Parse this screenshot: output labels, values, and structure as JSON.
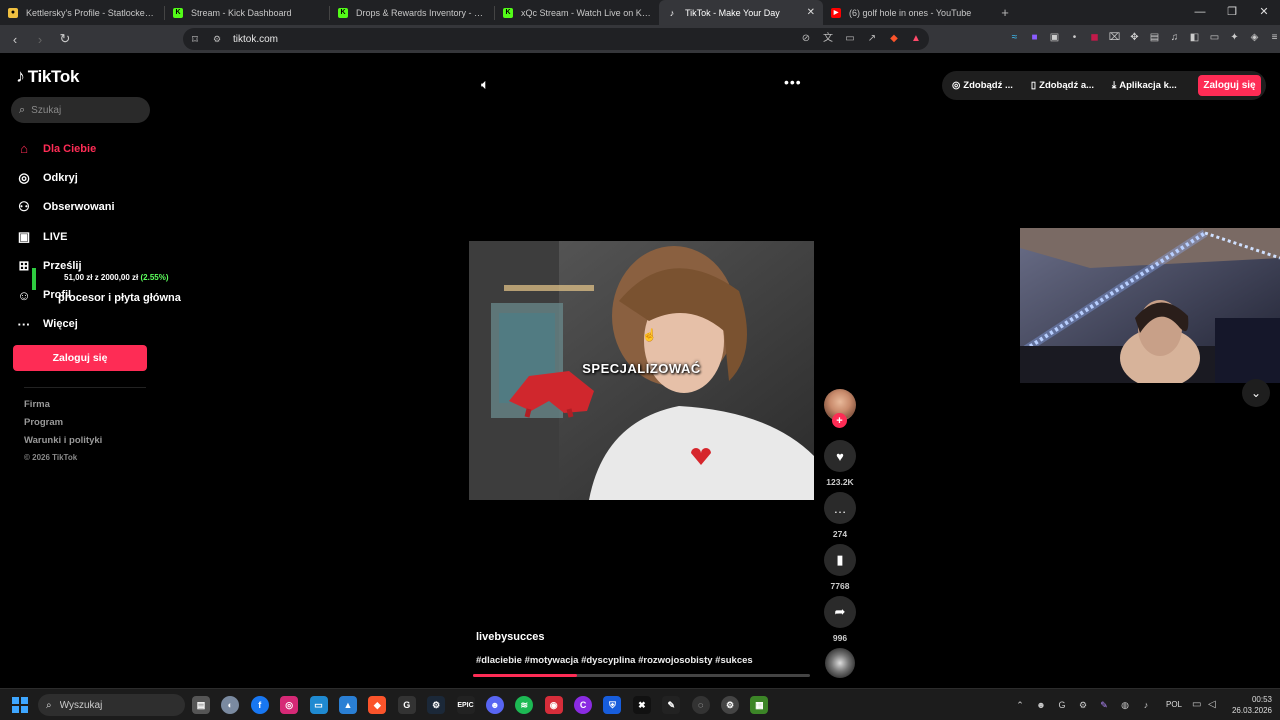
{
  "browser": {
    "tabs": [
      {
        "title": "Kettlersky's Profile - Statlocker.gg",
        "icon": "statlocker-icon",
        "color": "#f0c040",
        "active": false
      },
      {
        "title": "Stream - Kick Dashboard",
        "icon": "kick-icon",
        "color": "#53fc18",
        "active": false
      },
      {
        "title": "Drops & Rewards Inventory - Kick Stre...",
        "icon": "kick-icon",
        "color": "#53fc18",
        "active": false
      },
      {
        "title": "xQc Stream - Watch Live on Kick",
        "icon": "kick-icon",
        "color": "#53fc18",
        "active": false
      },
      {
        "title": "TikTok - Make Your Day",
        "icon": "tiktok-icon",
        "color": "#ffffff",
        "active": true
      },
      {
        "title": "(6) golf hole in ones - YouTube",
        "icon": "youtube-icon",
        "color": "#ff0000",
        "active": false
      }
    ],
    "url": "tiktok.com"
  },
  "tiktok": {
    "logo": "TikTok",
    "search_placeholder": "Szukaj",
    "nav": [
      {
        "label": "Dla Ciebie",
        "icon": "home-icon",
        "active": true
      },
      {
        "label": "Odkryj",
        "icon": "compass-icon",
        "active": false
      },
      {
        "label": "Obserwowani",
        "icon": "following-icon",
        "active": false
      },
      {
        "label": "LIVE",
        "icon": "live-icon",
        "active": false
      },
      {
        "label": "Prześlij",
        "icon": "upload-icon",
        "active": false
      },
      {
        "label": "Profil",
        "icon": "profile-icon",
        "active": false
      },
      {
        "label": "Więcej",
        "icon": "more-icon",
        "active": false
      }
    ],
    "login_button": "Zaloguj się",
    "footer": {
      "links": [
        "Firma",
        "Program",
        "Warunki i polityki"
      ],
      "copyright": "© 2026 TikTok"
    },
    "header": {
      "pills": [
        {
          "label": "Zdobądź ...",
          "icon": "coin-icon"
        },
        {
          "label": "Zdobądź a...",
          "icon": "phone-icon"
        },
        {
          "label": "Aplikacja k...",
          "icon": "download-icon"
        }
      ],
      "login": "Zaloguj się"
    },
    "video": {
      "caption": "SPECJALIZOWAĆ",
      "author": "livebysucces",
      "hashtags": "#dlaciebie #motywacja #dyscyplina #rozwojosobisty #sukces",
      "progress": 0.31
    },
    "actions": {
      "likes": "123.2K",
      "comments": "274",
      "saves": "7768",
      "shares": "996"
    }
  },
  "overlay": {
    "donation_amount": "51,00 zł z 2000,00 zł",
    "donation_percent": "(2.55%)",
    "donation_goal": "procesor i płyta główna"
  },
  "taskbar": {
    "search_placeholder": "Wyszukaj",
    "language": "POL",
    "time": "00:53",
    "date": "26.03.2026"
  }
}
